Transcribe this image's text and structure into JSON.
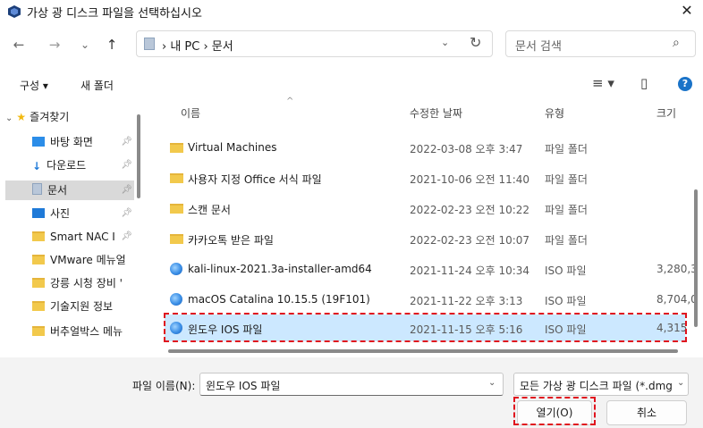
{
  "window": {
    "title": "가상 광 디스크 파일을 선택하십시오",
    "app_icon": "virtualbox-icon",
    "close_symbol": "✕"
  },
  "nav": {
    "back_symbol": "←",
    "forward_symbol": "→",
    "recent_symbol": "⌄",
    "up_symbol": "↑"
  },
  "address": {
    "path_text": "› 내 PC › 문서",
    "chevron": "⌄",
    "refresh_symbol": "↻"
  },
  "search": {
    "placeholder": "문서 검색",
    "icon": "⌕"
  },
  "commandbar": {
    "organize_label": "구성 ▾",
    "new_folder_label": "새 폴더",
    "view_symbol": "≡ ▾",
    "preview_symbol": "▯",
    "help_symbol": "?"
  },
  "sidebar": {
    "quick_access_label": "즐겨찾기",
    "items": [
      {
        "label": "바탕 화면",
        "icon": "desktop-icon",
        "pinned": true
      },
      {
        "label": "다운로드",
        "icon": "download-icon",
        "pinned": true
      },
      {
        "label": "문서",
        "icon": "documents-icon",
        "pinned": true,
        "selected": true
      },
      {
        "label": "사진",
        "icon": "pictures-icon",
        "pinned": true
      },
      {
        "label": "Smart NAC  I",
        "icon": "folder-icon",
        "pinned": true
      },
      {
        "label": "VMware 메뉴얼",
        "icon": "folder-icon"
      },
      {
        "label": "강릉 시청 장비 '",
        "icon": "folder-icon"
      },
      {
        "label": "기술지원 정보",
        "icon": "folder-icon"
      },
      {
        "label": "버추얼박스 메뉴",
        "icon": "folder-icon"
      }
    ]
  },
  "columns": {
    "name": "이름",
    "modified": "수정한 날짜",
    "type": "유형",
    "size": "크기"
  },
  "files": [
    {
      "name": "Virtual Machines",
      "modified": "2022-03-08 오후 3:47",
      "type": "파일 폴더",
      "size": "",
      "icon": "folder-icon"
    },
    {
      "name": "사용자 지정 Office 서식 파일",
      "modified": "2021-10-06 오전 11:40",
      "type": "파일 폴더",
      "size": "",
      "icon": "folder-icon"
    },
    {
      "name": "스캔 문서",
      "modified": "2022-02-23 오전 10:22",
      "type": "파일 폴더",
      "size": "",
      "icon": "folder-icon"
    },
    {
      "name": "카카오톡 받은 파일",
      "modified": "2022-02-23 오전 10:07",
      "type": "파일 폴더",
      "size": "",
      "icon": "folder-icon"
    },
    {
      "name": "kali-linux-2021.3a-installer-amd64",
      "modified": "2021-11-24 오후 10:34",
      "type": "ISO 파일",
      "size": "3,280,3",
      "icon": "iso-disc-icon"
    },
    {
      "name": "macOS Catalina 10.15.5 (19F101)",
      "modified": "2021-11-22 오후 3:13",
      "type": "ISO 파일",
      "size": "8,704,0",
      "icon": "iso-disc-icon"
    },
    {
      "name": "윈도우 IOS 파일",
      "modified": "2021-11-15 오후 5:16",
      "type": "ISO 파일",
      "size": "4,315",
      "icon": "iso-disc-icon",
      "selected": true
    }
  ],
  "footer": {
    "filename_label": "파일 이름(N):",
    "filename_value": "윈도우 IOS 파일",
    "filetype_value": "모든 가상 광 디스크 파일 (*.dmg",
    "open_label": "열기(O)",
    "cancel_label": "취소"
  },
  "colors": {
    "selection": "#cce8ff",
    "annotation_red": "#e0141e",
    "accent": "#1a73c8"
  }
}
